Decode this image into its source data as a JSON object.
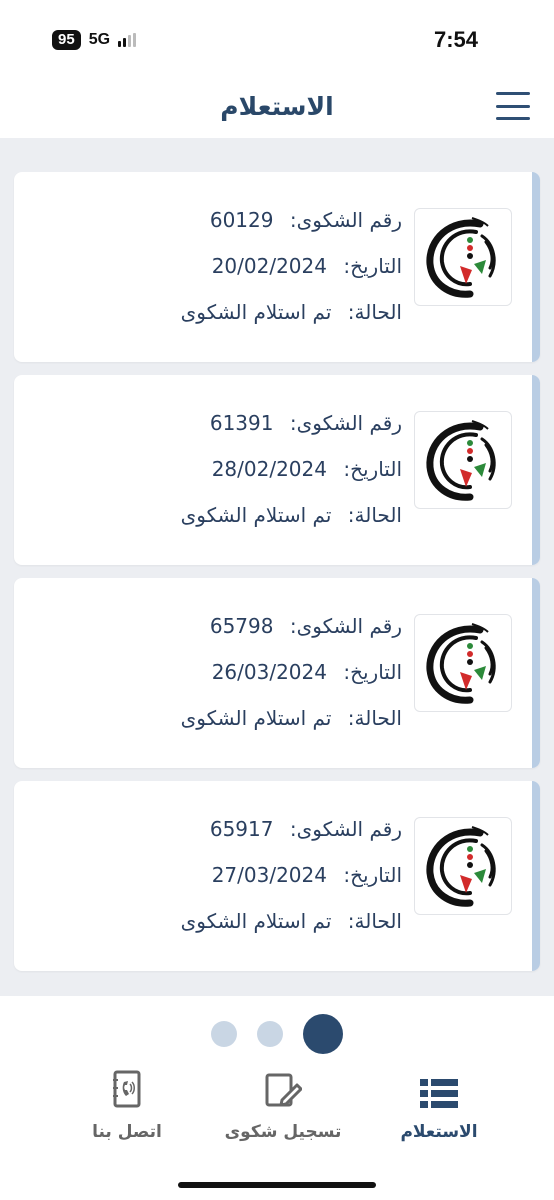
{
  "status_bar": {
    "battery": "95",
    "network": "5G",
    "time": "7:54"
  },
  "header": {
    "title": "الاستعلام"
  },
  "labels": {
    "number": "رقم الشكوى:",
    "date": "التاريخ:",
    "status": "الحالة:"
  },
  "complaints": [
    {
      "number": "60129",
      "date": "20/02/2024",
      "status": "تم استلام الشكوى"
    },
    {
      "number": "61391",
      "date": "28/02/2024",
      "status": "تم استلام الشكوى"
    },
    {
      "number": "65798",
      "date": "26/03/2024",
      "status": "تم استلام الشكوى"
    },
    {
      "number": "65917",
      "date": "27/03/2024",
      "status": "تم استلام الشكوى"
    }
  ],
  "pager": {
    "pages": 3,
    "active_index": 2
  },
  "tabs": [
    {
      "label": "اتصل بنا",
      "icon": "contact-book-icon",
      "active": false
    },
    {
      "label": "تسجيل شكوى",
      "icon": "edit-document-icon",
      "active": false
    },
    {
      "label": "الاستعلام",
      "icon": "list-icon",
      "active": true
    }
  ],
  "colors": {
    "primary": "#2b4a6e",
    "accent_bar": "#b9cde4",
    "background": "#eceef2",
    "inactive_dot": "#c9d6e4"
  }
}
